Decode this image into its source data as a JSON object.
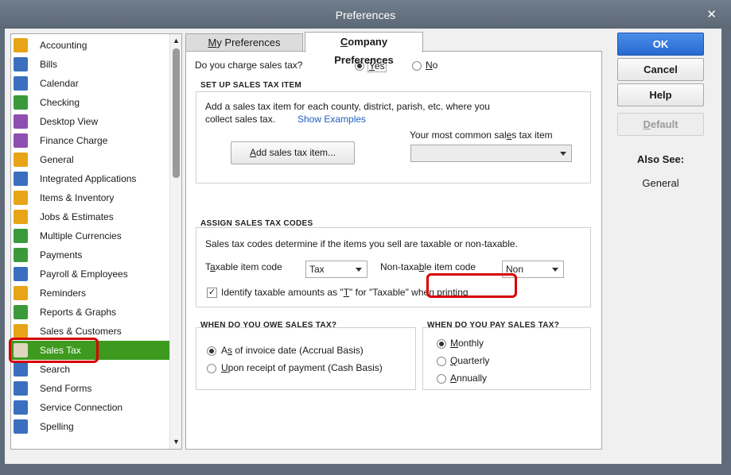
{
  "window": {
    "title": "Preferences",
    "close_glyph": "✕"
  },
  "sidebar": {
    "items": [
      {
        "label": "Accounting",
        "icon": "accounting-icon",
        "color": "#e8a317"
      },
      {
        "label": "Bills",
        "icon": "bills-icon",
        "color": "#3a6fbf"
      },
      {
        "label": "Calendar",
        "icon": "calendar-icon",
        "color": "#3a6fbf"
      },
      {
        "label": "Checking",
        "icon": "checking-icon",
        "color": "#3a9a3a"
      },
      {
        "label": "Desktop View",
        "icon": "desktop-view-icon",
        "color": "#8e4fb0"
      },
      {
        "label": "Finance Charge",
        "icon": "finance-charge-icon",
        "color": "#8e4fb0"
      },
      {
        "label": "General",
        "icon": "general-icon",
        "color": "#e8a317"
      },
      {
        "label": "Integrated Applications",
        "icon": "integrated-apps-icon",
        "color": "#3a6fbf"
      },
      {
        "label": "Items & Inventory",
        "icon": "items-inventory-icon",
        "color": "#e8a317"
      },
      {
        "label": "Jobs & Estimates",
        "icon": "jobs-estimates-icon",
        "color": "#e8a317"
      },
      {
        "label": "Multiple Currencies",
        "icon": "multiple-currencies-icon",
        "color": "#3a9a3a"
      },
      {
        "label": "Payments",
        "icon": "payments-icon",
        "color": "#3a9a3a"
      },
      {
        "label": "Payroll & Employees",
        "icon": "payroll-icon",
        "color": "#3a6fbf"
      },
      {
        "label": "Reminders",
        "icon": "reminders-icon",
        "color": "#e8a317"
      },
      {
        "label": "Reports & Graphs",
        "icon": "reports-graphs-icon",
        "color": "#3a9a3a"
      },
      {
        "label": "Sales & Customers",
        "icon": "sales-customers-icon",
        "color": "#e8a317"
      },
      {
        "label": "Sales Tax",
        "icon": "sales-tax-icon",
        "color": "#c97a2a"
      },
      {
        "label": "Search",
        "icon": "search-icon",
        "color": "#3a6fbf"
      },
      {
        "label": "Send Forms",
        "icon": "send-forms-icon",
        "color": "#3a6fbf"
      },
      {
        "label": "Service Connection",
        "icon": "service-connection-icon",
        "color": "#3a6fbf"
      },
      {
        "label": "Spelling",
        "icon": "spelling-icon",
        "color": "#3a6fbf"
      }
    ],
    "selected": "Sales Tax"
  },
  "tabs": {
    "my_pref_underline": "M",
    "my_pref_rest": "y Preferences",
    "company_pref_underline": "C",
    "company_pref_rest": "ompany Preferences"
  },
  "question": {
    "text": "Do you charge sales tax?",
    "yes_u": "Y",
    "yes_rest": "es",
    "no_u": "N",
    "no_rest": "o",
    "selected": "Yes"
  },
  "setup": {
    "title": "SET UP SALES TAX ITEM",
    "desc_line1": "Add a sales tax item for each county, district, parish, etc. where you",
    "desc_line2": "collect sales tax.",
    "show_examples": "Show Examples",
    "add_btn_u": "A",
    "add_btn_rest": "dd sales tax item...",
    "common_label_a": "Your most common sal",
    "common_label_u": "e",
    "common_label_b": "s tax item",
    "common_value": ""
  },
  "assign": {
    "title": "ASSIGN SALES TAX CODES",
    "desc": "Sales tax codes determine if the items you sell are taxable or non-taxable.",
    "taxable_a": "T",
    "taxable_u": "a",
    "taxable_b": "xable item code",
    "taxable_value": "Tax",
    "nontaxable_a": "Non-taxa",
    "nontaxable_u": "b",
    "nontaxable_b": "le item code",
    "nontaxable_value": "Non",
    "identify_a": "Identify taxable amounts as \"",
    "identify_u": "T",
    "identify_b": "\" for \"Taxable\" when printing",
    "identify_checked": true
  },
  "owe": {
    "title": "WHEN DO YOU OWE SALES TAX?",
    "accrual_a": "A",
    "accrual_u": "s",
    "accrual_b": " of invoice date (Accrual Basis)",
    "cash_u": "U",
    "cash_b": "pon receipt of payment (Cash Basis)",
    "selected": "accrual"
  },
  "pay": {
    "title": "WHEN DO YOU PAY SALES TAX?",
    "monthly_u": "M",
    "monthly_b": "onthly",
    "quarterly_u": "Q",
    "quarterly_b": "uarterly",
    "annually_u": "A",
    "annually_b": "nnually",
    "selected": "monthly"
  },
  "buttons": {
    "ok": "OK",
    "cancel": "Cancel",
    "help": "Help",
    "default_u": "D",
    "default_b": "efault"
  },
  "also_see": {
    "title": "Also See:",
    "items": [
      "General"
    ]
  },
  "colors": {
    "selected_green": "#3d9a1f",
    "highlight_red": "#d60000",
    "ok_blue": "#2869d2",
    "link_blue": "#1f5fbf"
  }
}
